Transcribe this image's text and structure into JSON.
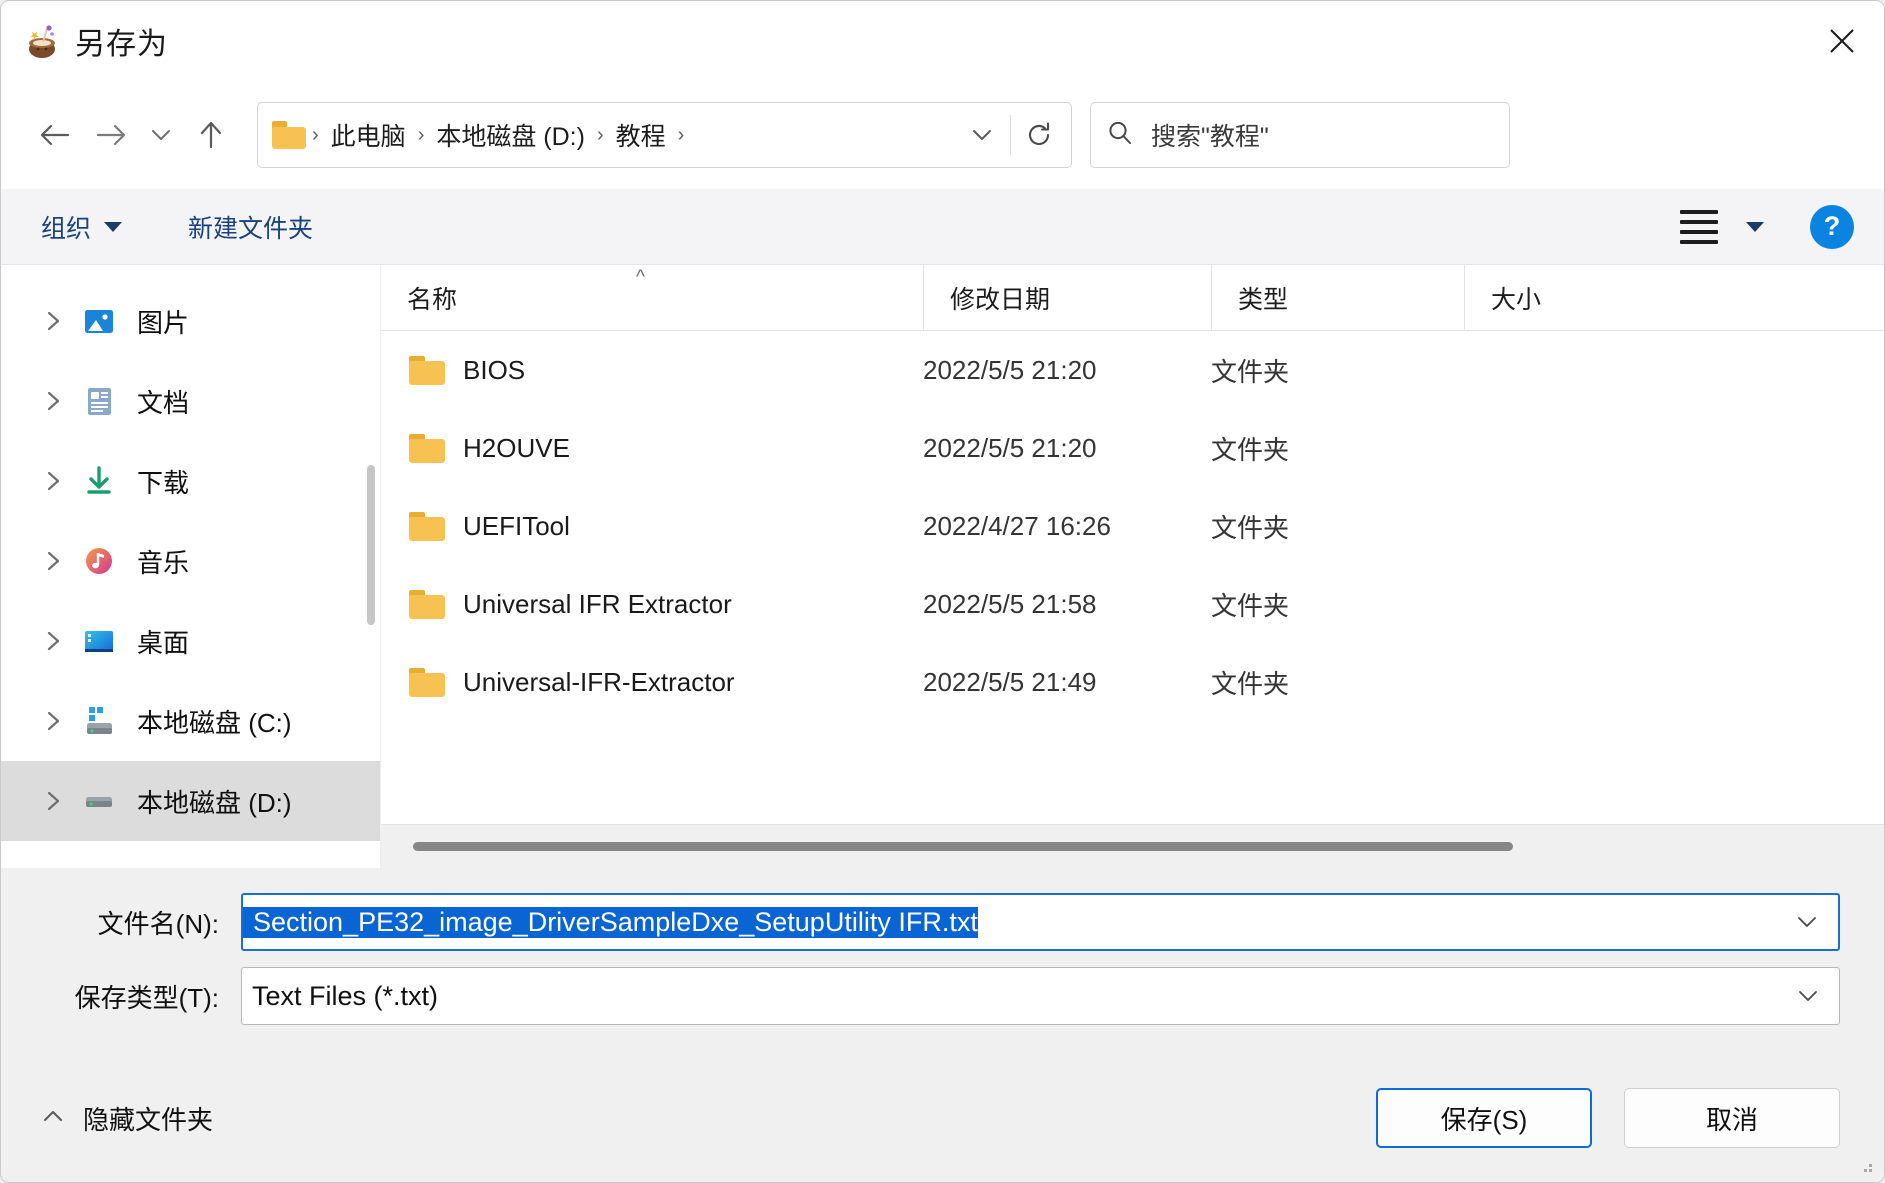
{
  "window": {
    "title": "另存为",
    "icon": "cauldron-icon",
    "close_label": "✕"
  },
  "nav": {
    "back_icon": "arrow-left-icon",
    "forward_icon": "arrow-right-icon",
    "recent_icon": "chevron-down-icon",
    "up_icon": "arrow-up-icon",
    "breadcrumb": [
      "此电脑",
      "本地磁盘 (D:)",
      "教程"
    ],
    "breadcrumb_separator": "›",
    "dropdown_icon": "chevron-down-icon",
    "refresh_icon": "refresh-icon"
  },
  "search": {
    "icon": "search-icon",
    "placeholder": "搜索\"教程\""
  },
  "commandbar": {
    "organize_label": "组织",
    "new_folder_label": "新建文件夹",
    "view_icon": "list-view-icon",
    "view_caret_icon": "caret-down-icon",
    "help_label": "?"
  },
  "sidebar": {
    "items": [
      {
        "label": "图片",
        "icon": "pictures-icon",
        "selected": false
      },
      {
        "label": "文档",
        "icon": "documents-icon",
        "selected": false
      },
      {
        "label": "下载",
        "icon": "downloads-icon",
        "selected": false
      },
      {
        "label": "音乐",
        "icon": "music-icon",
        "selected": false
      },
      {
        "label": "桌面",
        "icon": "desktop-icon",
        "selected": false
      },
      {
        "label": "本地磁盘 (C:)",
        "icon": "windows-drive-icon",
        "selected": false
      },
      {
        "label": "本地磁盘 (D:)",
        "icon": "drive-icon",
        "selected": true
      }
    ],
    "expand_icon": "chevron-right-icon"
  },
  "filelist": {
    "columns": [
      "名称",
      "修改日期",
      "类型",
      "大小"
    ],
    "sort_column": "名称",
    "sort_indicator": "^",
    "rows": [
      {
        "name": "BIOS",
        "modified": "2022/5/5 21:20",
        "type": "文件夹",
        "size": ""
      },
      {
        "name": "H2OUVE",
        "modified": "2022/5/5 21:20",
        "type": "文件夹",
        "size": ""
      },
      {
        "name": "UEFITool",
        "modified": "2022/4/27 16:26",
        "type": "文件夹",
        "size": ""
      },
      {
        "name": "Universal IFR Extractor",
        "modified": "2022/5/5 21:58",
        "type": "文件夹",
        "size": ""
      },
      {
        "name": "Universal-IFR-Extractor",
        "modified": "2022/5/5 21:49",
        "type": "文件夹",
        "size": ""
      }
    ]
  },
  "form": {
    "filename_label": "文件名(N):",
    "filename_value": "Section_PE32_image_DriverSampleDxe_SetupUtility IFR.txt",
    "filetype_label": "保存类型(T):",
    "filetype_value": "Text Files (*.txt)",
    "dropdown_icon": "chevron-down-icon"
  },
  "footer": {
    "hide_folders_label": "隐藏文件夹",
    "hide_folders_icon": "chevron-up-icon",
    "save_label": "保存(S)",
    "cancel_label": "取消"
  },
  "colors": {
    "accent": "#0a6cd4",
    "selection": "#0a65d4",
    "link": "#19427e",
    "folder": "#f7c251",
    "help": "#0a84e0"
  }
}
